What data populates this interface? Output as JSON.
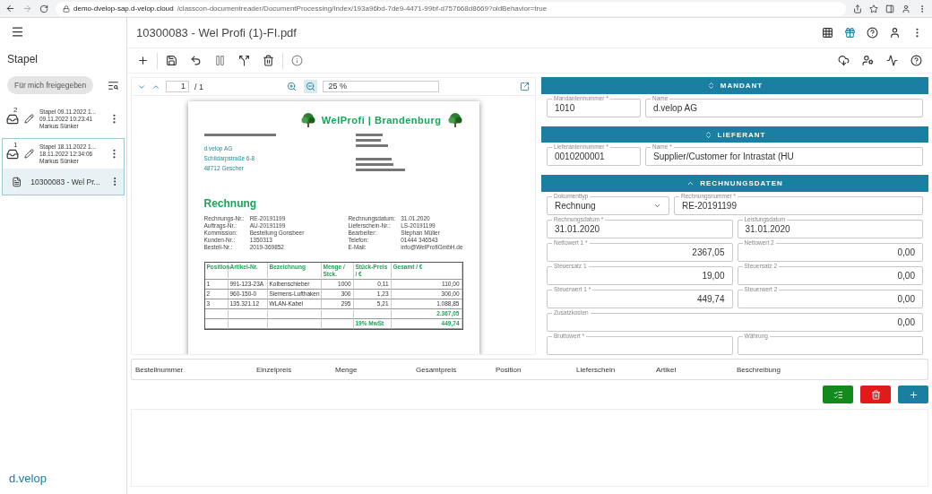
{
  "browser": {
    "host": "demo-dvelop-sap.d-velop.cloud",
    "path": "/classcon-documentreader/DocumentProcessing/Index/193a96bd-7de9-4471-99bf-d757668d8669?oldBehavior=true"
  },
  "sidebar": {
    "title": "Stapel",
    "filter": "Für mich freigegeben",
    "batches": [
      {
        "count": "2",
        "title": "Stapel 09.11.2022 1...",
        "date": "09.11.2022 10:23:41",
        "user": "Markus Sünker",
        "selected": false
      },
      {
        "count": "1",
        "title": "Stapel 18.11.2022 1...",
        "date": "18.11.2022 12:34:06",
        "user": "Markus Sünker",
        "selected": true,
        "children": [
          {
            "title": "10300083 - Wel Pr...",
            "selected": true
          }
        ]
      }
    ],
    "logo": "d.velop"
  },
  "header": {
    "title": "10300083 - Wel Profi (1)-FI.pdf"
  },
  "viewer": {
    "page": "1",
    "page_count": "/ 1",
    "zoom": "25 %",
    "zoom_buttons": [
      {
        "kind": "zoom-in",
        "selected": false
      },
      {
        "kind": "zoom-out",
        "selected": true
      }
    ],
    "document": {
      "brand": "WelProfi | Brandenburg",
      "recipient": [
        "d.velop AG",
        "Schildarpstraße 6-8",
        "48712 Gescher"
      ],
      "heading": "Rechnung",
      "meta_left": [
        {
          "label": "Rechnungs-Nr.:",
          "value": "RE-20191199"
        },
        {
          "label": "Auftrags-Nr.:",
          "value": "AU-20191199"
        },
        {
          "label": "Kommission:",
          "value": "Bestellung Gonsbeer"
        },
        {
          "label": "Kunden-Nr.:",
          "value": "1350313"
        },
        {
          "label": "Bestell-Nr.:",
          "value": "2019-369852"
        }
      ],
      "meta_right": [
        {
          "label": "Rechnungsdatum:",
          "value": "31.01.2020"
        },
        {
          "label": "Lieferschein-Nr.:",
          "value": "LS-20191199"
        },
        {
          "label": "Bearbeiter:",
          "value": "Stephan Müller"
        },
        {
          "label": "Telefon:",
          "value": "01444 346543"
        },
        {
          "label": "E-Mail:",
          "value": "info@WelProfiGmbH.de"
        }
      ],
      "columns": [
        "Position",
        "Artikel-Nr.",
        "Bezeichnung",
        "Menge / Stck.",
        "Stück-Preis / €",
        "Gesamt / €"
      ],
      "rows": [
        [
          "1",
          "991-123-23A",
          "Kolbenschieber",
          "1000",
          "0,11",
          "110,00"
        ],
        [
          "2",
          "960-150-0",
          "Siemens-Lufthaken",
          "300",
          "1,23",
          "300,00"
        ],
        [
          "3",
          "135.321.12",
          "WLAN-Kabel",
          "295",
          "5,21",
          "1.088,85"
        ]
      ],
      "subtotal": "2.367,05",
      "tax_label": "19% MwSt",
      "tax_value": "449,74"
    }
  },
  "form": {
    "sections": [
      {
        "title": "MANDANT",
        "expanded": false,
        "rows": [
          [
            {
              "label": "Mandantennummer *",
              "value": "1010",
              "kind": "id"
            },
            {
              "label": "Name",
              "value": "d.velop AG",
              "kind": "text"
            }
          ]
        ]
      },
      {
        "title": "LIEFERANT",
        "expanded": false,
        "rows": [
          [
            {
              "label": "Lieferantennummer *",
              "value": "0010200001",
              "kind": "id"
            },
            {
              "label": "Name *",
              "value": "Supplier/Customer for Intrastat (HU",
              "kind": "text"
            }
          ]
        ]
      },
      {
        "title": "RECHNUNGSDATEN",
        "expanded": true,
        "top_fields": [
          {
            "label": "Dokumenttyp",
            "value": "Rechnung",
            "kind": "select"
          },
          {
            "label": "Rechnungsnummer *",
            "value": "RE-20191199",
            "kind": "text"
          }
        ],
        "rows": [
          [
            {
              "label": "Rechnungsdatum *",
              "value": "31.01.2020",
              "kind": "text"
            },
            {
              "label": "Leistungsdatum",
              "value": "31.01.2020",
              "kind": "text"
            }
          ],
          [
            {
              "label": "Nettowert 1 *",
              "value": "2367,05",
              "kind": "amount"
            },
            {
              "label": "Nettowert 2",
              "value": "0,00",
              "kind": "amount"
            }
          ],
          [
            {
              "label": "Steuersatz 1",
              "value": "19,00",
              "kind": "amount"
            },
            {
              "label": "Steuersatz 2",
              "value": "0,00",
              "kind": "amount"
            }
          ],
          [
            {
              "label": "Steuerwert 1 *",
              "value": "449,74",
              "kind": "amount"
            },
            {
              "label": "Steuerwert 2",
              "value": "0,00",
              "kind": "amount"
            }
          ],
          [
            {
              "label": "Zusatzkosten",
              "value": "0,00",
              "kind": "amount"
            }
          ],
          [
            {
              "label": "Bruttowert *",
              "kind": "amount"
            },
            {
              "label": "Währung",
              "kind": "text"
            }
          ]
        ]
      }
    ]
  },
  "positions": {
    "columns": [
      "Bestellnummer",
      "Einzelpreis",
      "Menge",
      "Gesamtpreis",
      "Position",
      "Lieferschein",
      "Artikel",
      "Beschreibung"
    ],
    "actions": [
      {
        "kind": "approve"
      },
      {
        "kind": "delete"
      },
      {
        "kind": "add"
      }
    ]
  }
}
